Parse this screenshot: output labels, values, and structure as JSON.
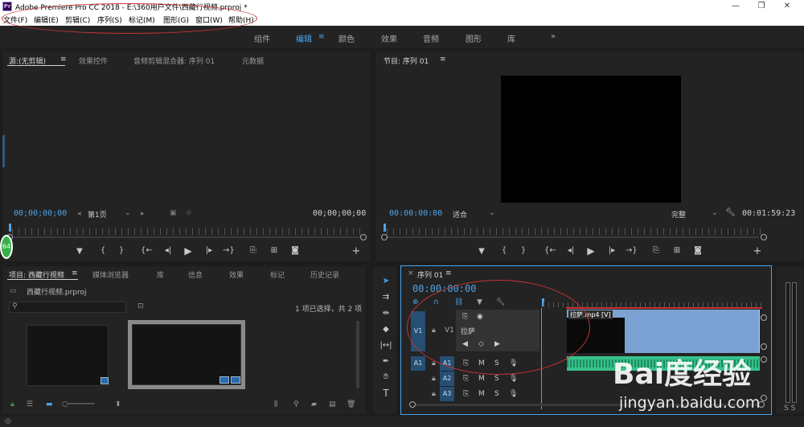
{
  "window": {
    "title": "Adobe Premiere Pro CC 2018 - E:\\360用户文件\\西藏行视频.prproj *",
    "minimize": "—",
    "maximize": "❐",
    "close": "✕"
  },
  "menu": [
    "文件(F)",
    "编辑(E)",
    "剪辑(C)",
    "序列(S)",
    "标记(M)",
    "图形(G)",
    "窗口(W)",
    "帮助(H)"
  ],
  "workspaces": {
    "items": [
      "组件",
      "编辑",
      "颜色",
      "效果",
      "音频",
      "图形",
      "库"
    ],
    "active": "编辑",
    "more": "»"
  },
  "source_panel": {
    "tabs": [
      "源:(无剪辑)",
      "效果控件",
      "音频剪辑混合器: 序列 01",
      "元数据"
    ],
    "timecode_left": "00;00;00;00",
    "page": "第1页",
    "timecode_right": "00;00;00;00"
  },
  "program_panel": {
    "tab": "节目: 序列 01",
    "timecode_left": "00:00:00:00",
    "fit": "适合",
    "quality": "完整",
    "duration": "00:01:59:23"
  },
  "project_panel": {
    "tabs": [
      "项目: 西藏行视频",
      "媒体浏览器",
      "库",
      "信息",
      "效果",
      "标记",
      "历史记录"
    ],
    "file": "西藏行视频.prproj",
    "selection_info": "1 项已选择，共 2 项",
    "badge": "64"
  },
  "timeline": {
    "tab": "序列 01",
    "timecode": "00:00:00:00",
    "popup_label": "拉萨",
    "tracks": {
      "video": [
        {
          "name": "V1",
          "label": "V1"
        }
      ],
      "audio": [
        {
          "name": "A1",
          "label": "A1",
          "m": "M",
          "s": "S"
        },
        {
          "name": "A2",
          "label": "A2",
          "m": "M",
          "s": "S"
        },
        {
          "name": "A3",
          "label": "A3",
          "m": "M",
          "s": "S"
        }
      ]
    },
    "clip_label": "拉萨.mp4 [V]",
    "audio_clip_label": ""
  },
  "watermark": {
    "line1": "Bai度经验",
    "line2": "jingyan.baidu.com"
  },
  "colors": {
    "accent": "#4ba3e9",
    "clip_video": "#7ca2d3",
    "clip_audio": "#36c28a",
    "annotation": "#c83232"
  }
}
